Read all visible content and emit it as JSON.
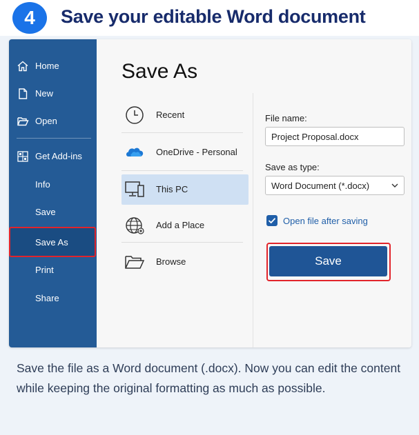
{
  "header": {
    "step_number": "4",
    "title": "Save your editable Word document"
  },
  "sidebar": {
    "items": [
      {
        "label": "Home",
        "icon": "home-icon"
      },
      {
        "label": "New",
        "icon": "new-document-icon"
      },
      {
        "label": "Open",
        "icon": "folder-open-icon"
      },
      {
        "label": "Get Add-ins",
        "icon": "add-ins-grid-icon"
      },
      {
        "label": "Info"
      },
      {
        "label": "Save"
      },
      {
        "label": "Save As"
      },
      {
        "label": "Print"
      },
      {
        "label": "Share"
      }
    ],
    "active_item": "Save As"
  },
  "main": {
    "title": "Save As",
    "locations": [
      {
        "label": "Recent",
        "icon": "clock-icon"
      },
      {
        "label": "OneDrive - Personal",
        "icon": "onedrive-cloud-icon"
      },
      {
        "label": "This PC",
        "icon": "computer-icon"
      },
      {
        "label": "Add a Place",
        "icon": "globe-icon"
      },
      {
        "label": "Browse",
        "icon": "folder-icon"
      }
    ],
    "selected_location": "This PC"
  },
  "save_panel": {
    "file_name_label": "File name:",
    "file_name_value": "Project Proposal.docx",
    "save_type_label": "Save as type:",
    "save_type_value": "Word Document (*.docx)",
    "open_after_label": "Open file after saving",
    "open_after_checked": true,
    "save_button_label": "Save"
  },
  "caption": "Save the file as a Word document (.docx). Now you can edit the content while keeping the original formatting as much as possible.",
  "colors": {
    "sidebar": "#245b96",
    "accent": "#1f5596",
    "highlight": "#e2242b",
    "step_circle": "#1a73e8",
    "title_text": "#172b6b"
  }
}
